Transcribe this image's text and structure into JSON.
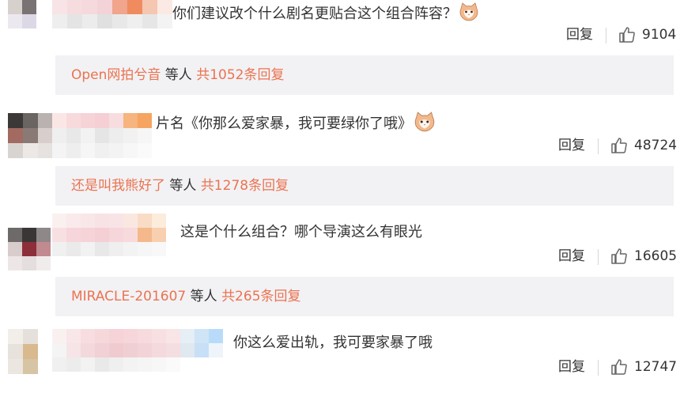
{
  "comments": [
    {
      "text": "你们建议改个什么剧名更贴合这个组合阵容？",
      "has_emoji": true,
      "emoji": "cat-face-icon",
      "reply_label": "回复",
      "likes": "9104"
    },
    {
      "text": "片名《你那么爱家暴，我可要绿你了哦》",
      "has_emoji": true,
      "emoji": "cat-face-icon",
      "reply_label": "回复",
      "likes": "48724"
    },
    {
      "text": "这是个什么组合？哪个导演这么有眼光",
      "has_emoji": false,
      "reply_label": "回复",
      "likes": "16605"
    },
    {
      "text": "你这么爱出轨，我可要家暴了哦",
      "has_emoji": false,
      "reply_label": "回复",
      "likes": "12747"
    }
  ],
  "reply_summaries": [
    {
      "user": "Open网拍兮音",
      "middle": " 等人 ",
      "total": "共1052条回复"
    },
    {
      "user": "还是叫我熊好了",
      "middle": " 等人 ",
      "total": "共1278条回复"
    },
    {
      "user": "MIRACLE-201607",
      "middle": " 等人 ",
      "total": "共265条回复"
    }
  ],
  "colors": {
    "accent": "#eb7350",
    "reply_bar_bg": "#f2f2f5",
    "text": "#333333"
  }
}
